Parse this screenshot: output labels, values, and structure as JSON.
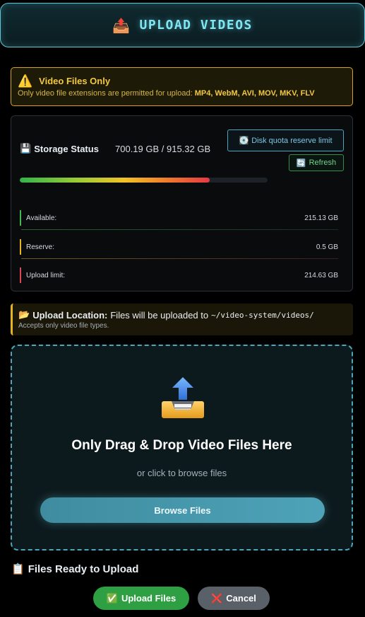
{
  "header": {
    "title": "UPLOAD VIDEOS",
    "icon": "upload-tray-icon"
  },
  "warning": {
    "icon": "warning-icon",
    "title": "Video Files Only",
    "text_prefix": "Only video file extensions are permitted for upload:",
    "extensions": "MP4, WebM, AVI, MOV, MKV, FLV"
  },
  "storage": {
    "icon": "floppy-disk-icon",
    "label": "Storage Status",
    "value": "700.19 GB / 915.32 GB",
    "used_fraction": 0.765,
    "quota_button": {
      "icon": "disc-icon",
      "label": "Disk quota reserve limit"
    },
    "refresh_button": {
      "icon": "refresh-icon",
      "label": "Refresh"
    },
    "rows": [
      {
        "label": "Available:",
        "value": "215.13 GB",
        "color": "#3fb950"
      },
      {
        "label": "Reserve:",
        "value": "0.5 GB",
        "color": "#e7b31f"
      },
      {
        "label": "Upload limit:",
        "value": "214.63 GB",
        "color": "#e04553"
      }
    ]
  },
  "location": {
    "icon": "open-folder-icon",
    "label": "Upload Location:",
    "text": "Files will be uploaded to",
    "path": "~/video-system/videos/",
    "sub": "Accepts only video file types."
  },
  "dropzone": {
    "title": "Only Drag & Drop Video Files Here",
    "subtitle": "or click to browse files",
    "browse_label": "Browse Files"
  },
  "files": {
    "icon": "clipboard-icon",
    "title": "Files Ready to Upload",
    "upload_label": "Upload Files",
    "cancel_label": "Cancel"
  },
  "colors": {
    "accent": "#7ee7f4",
    "warning": "#f3c940",
    "success": "#2ea043",
    "danger": "#e04553"
  }
}
